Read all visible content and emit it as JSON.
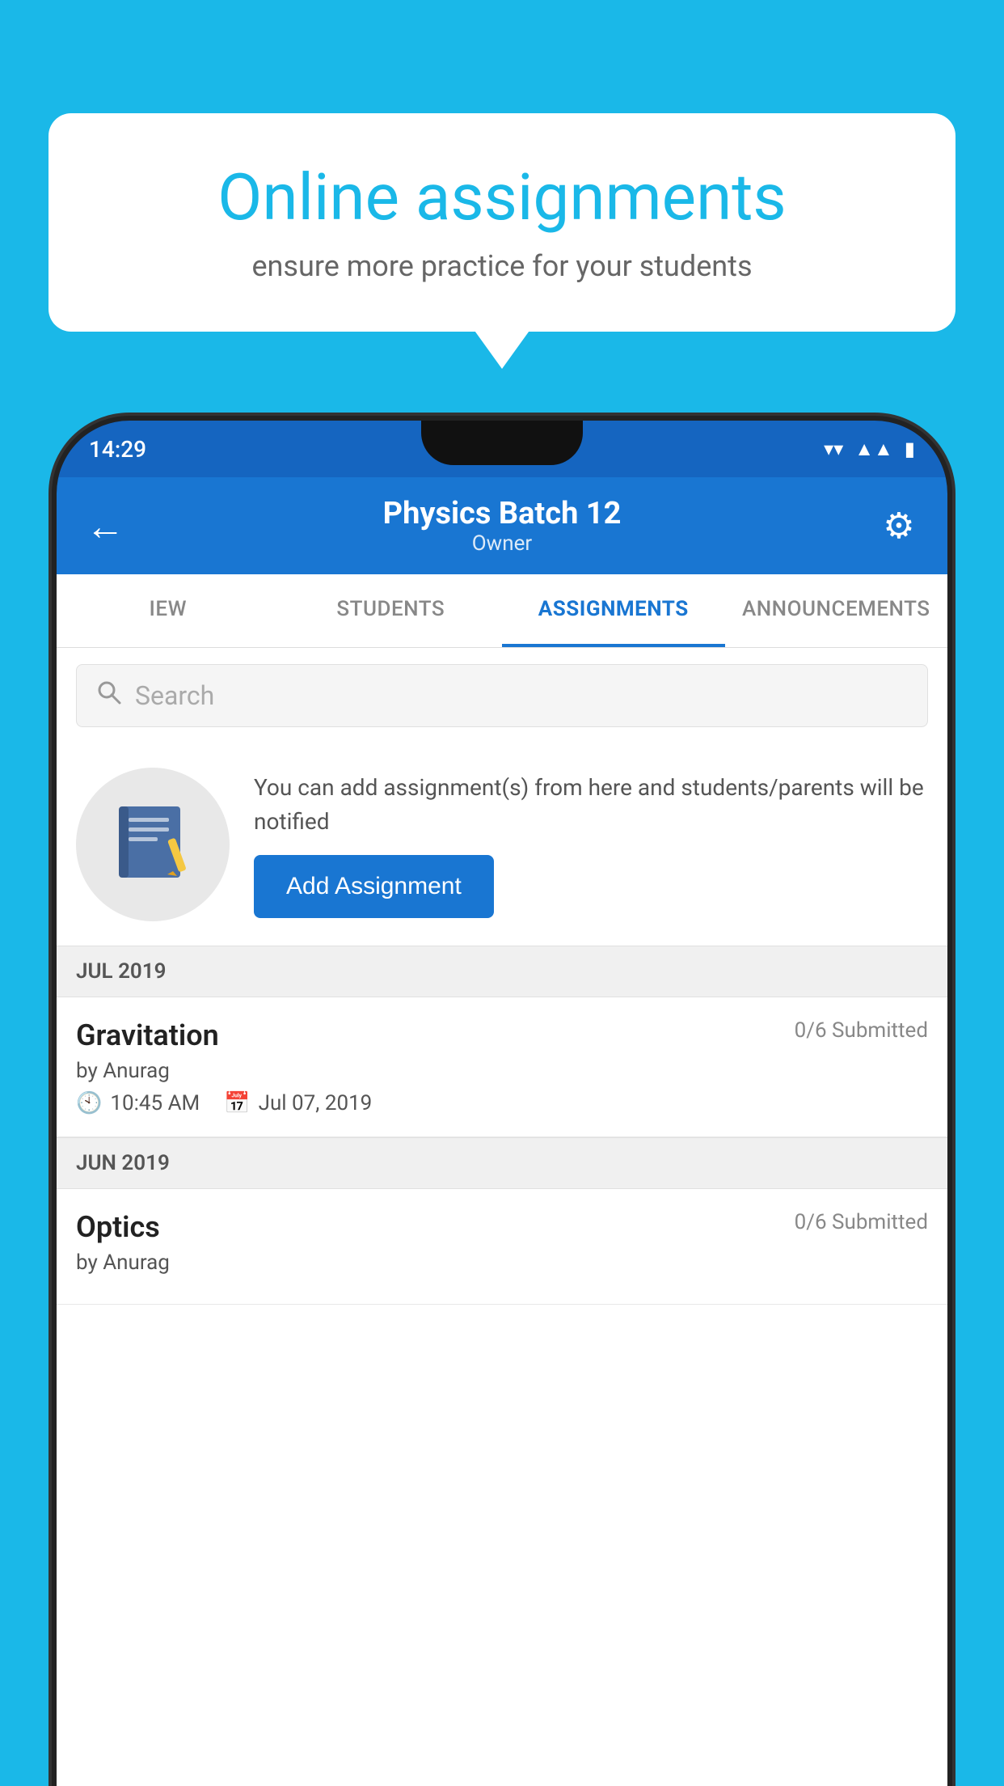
{
  "background": {
    "color": "#1ab8e8"
  },
  "speech_bubble": {
    "title": "Online assignments",
    "subtitle": "ensure more practice for your students"
  },
  "status_bar": {
    "time": "14:29",
    "icons": [
      "wifi",
      "signal",
      "battery"
    ]
  },
  "header": {
    "title": "Physics Batch 12",
    "subtitle": "Owner",
    "back_label": "←",
    "settings_label": "⚙"
  },
  "tabs": [
    {
      "label": "IEW",
      "active": false
    },
    {
      "label": "STUDENTS",
      "active": false
    },
    {
      "label": "ASSIGNMENTS",
      "active": true
    },
    {
      "label": "ANNOUNCEMENTS",
      "active": false
    }
  ],
  "search": {
    "placeholder": "Search"
  },
  "add_assignment": {
    "description": "You can add assignment(s) from here and students/parents will be notified",
    "button_label": "Add Assignment"
  },
  "month_sections": [
    {
      "month": "JUL 2019",
      "assignments": [
        {
          "title": "Gravitation",
          "submitted": "0/6 Submitted",
          "by": "by Anurag",
          "time": "10:45 AM",
          "date": "Jul 07, 2019"
        }
      ]
    },
    {
      "month": "JUN 2019",
      "assignments": [
        {
          "title": "Optics",
          "submitted": "0/6 Submitted",
          "by": "by Anurag",
          "time": "",
          "date": ""
        }
      ]
    }
  ]
}
